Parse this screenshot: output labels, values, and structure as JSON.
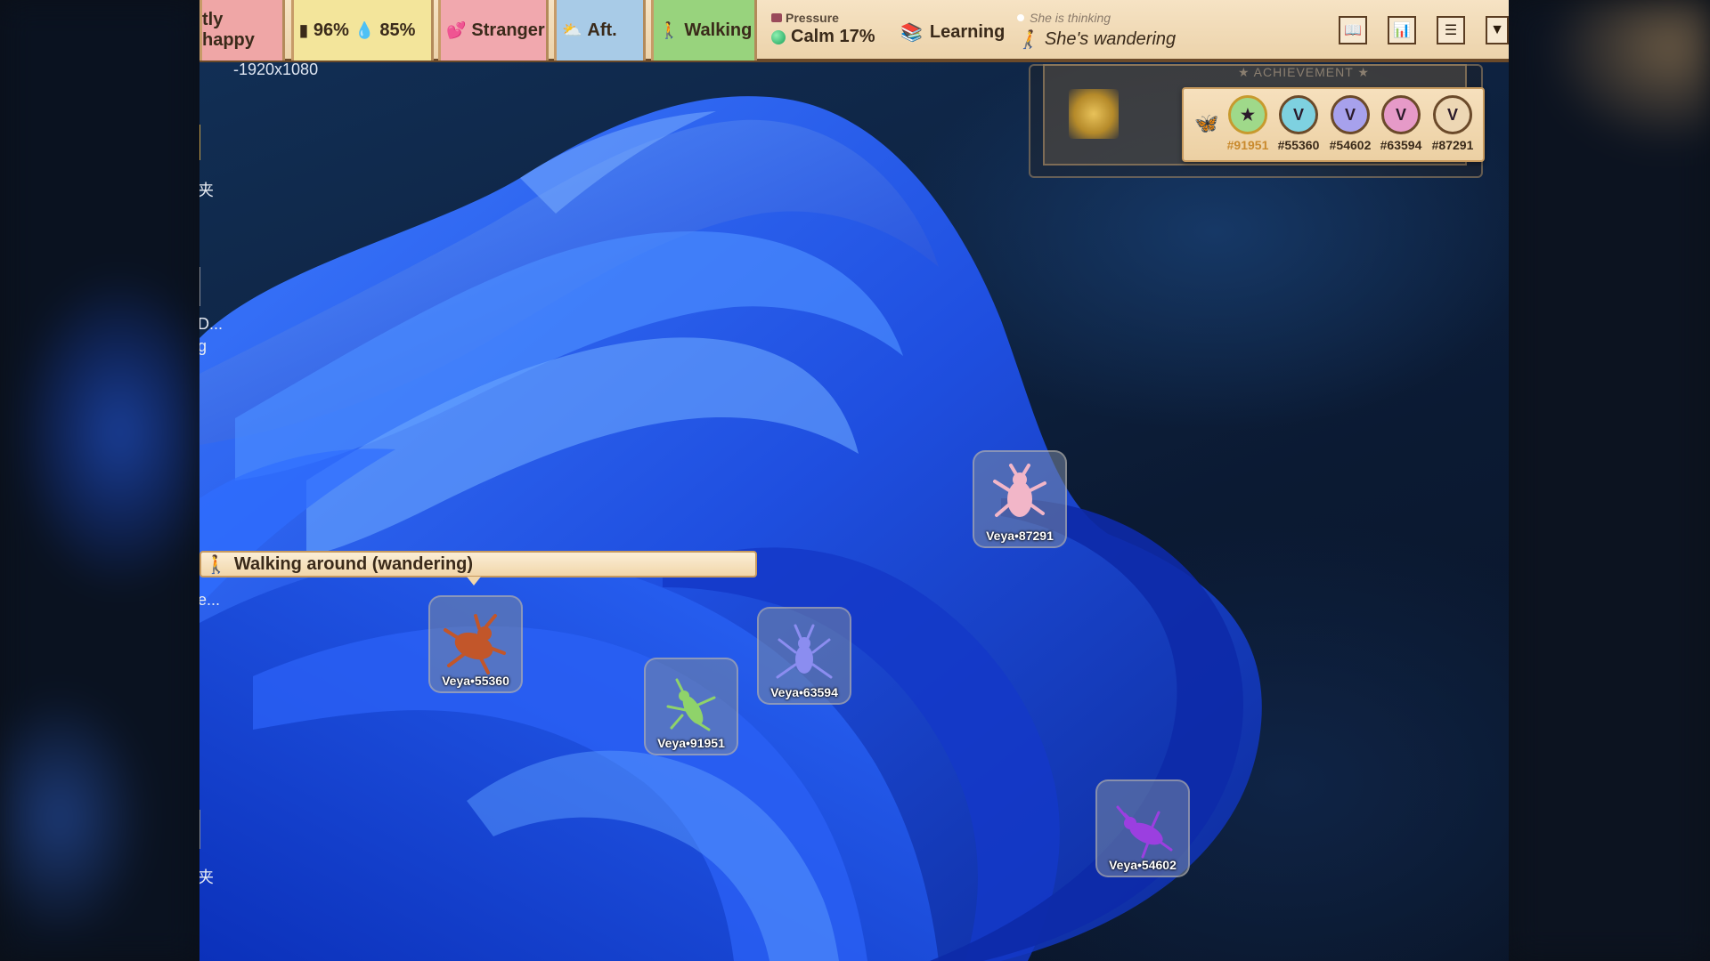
{
  "topbar": {
    "mood": "tly happy",
    "energy": "96%",
    "hydration": "85%",
    "relationship": "Stranger",
    "time_of_day": "Aft.",
    "activity": "Walking",
    "pressure_label": "Pressure",
    "pressure_value": "Calm 17%",
    "learning": "Learning",
    "thinking_label": "She is thinking",
    "thinking_value": "She's wandering",
    "buttons": [
      "book-icon",
      "stats-icon",
      "menu-icon",
      "collapse-icon"
    ]
  },
  "desktop": {
    "resolution_label": "-1920x1080",
    "peek_texts": [
      "夹",
      "D...",
      "g",
      "e...",
      "夹"
    ]
  },
  "achievement": {
    "title": "★ ACHIEVEMENT ★",
    "veyas": [
      {
        "label": "★",
        "id": "#91951",
        "color": "#9fd98a",
        "id_color": "#c98a2e"
      },
      {
        "label": "V",
        "id": "#55360",
        "color": "#7ed1e0",
        "id_color": "#3a2a1a"
      },
      {
        "label": "V",
        "id": "#54602",
        "color": "#a7a1ec",
        "id_color": "#3a2a1a"
      },
      {
        "label": "V",
        "id": "#63594",
        "color": "#e69ac8",
        "id_color": "#3a2a1a"
      },
      {
        "label": "V",
        "id": "#87291",
        "color": "#edd7b4",
        "id_color": "#3a2a1a"
      }
    ]
  },
  "bubble": {
    "text": "Walking around (wandering)"
  },
  "pets": [
    {
      "name": "Veya•87291",
      "color": "#f2b6c8"
    },
    {
      "name": "Veya•55360",
      "color": "#c2562a"
    },
    {
      "name": "Veya•63594",
      "color": "#8b8df0"
    },
    {
      "name": "Veya•91951",
      "color": "#8fd36a"
    },
    {
      "name": "Veya•54602",
      "color": "#9b3fe0"
    }
  ]
}
